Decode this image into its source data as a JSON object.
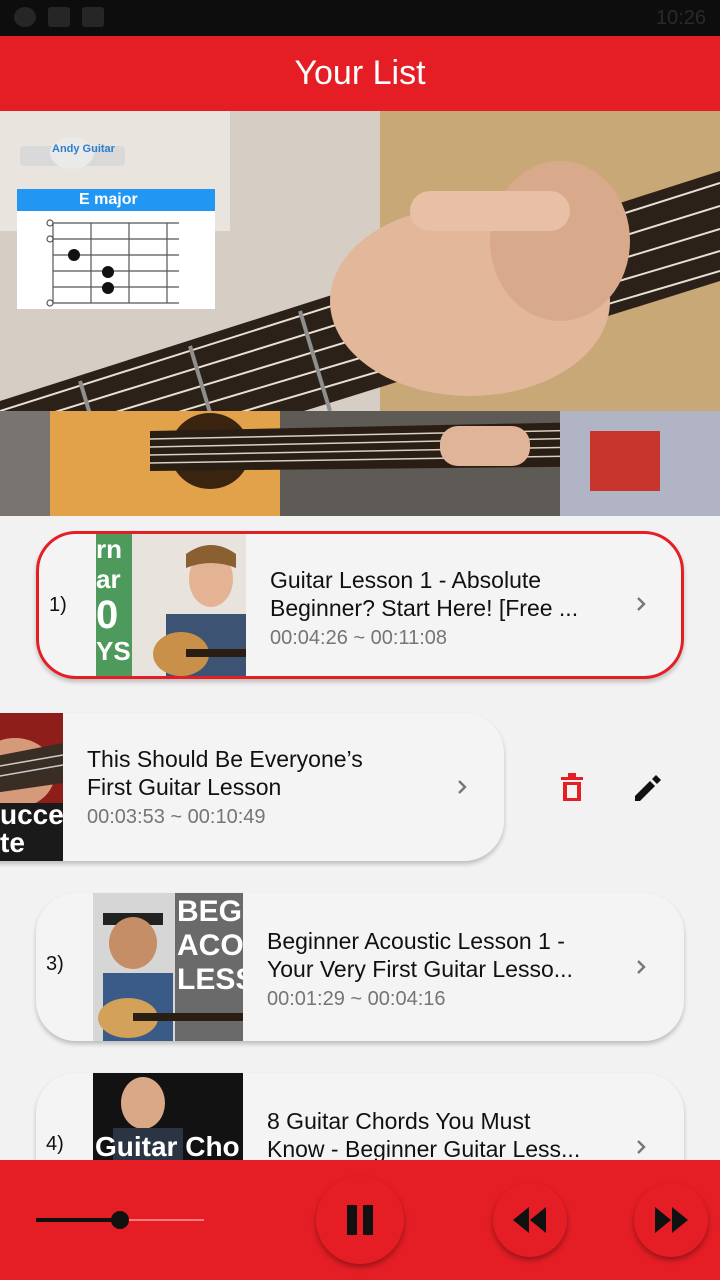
{
  "status_bar": {
    "time": "10:26"
  },
  "app_bar": {
    "title": "Your List"
  },
  "player": {
    "overlay_logo": "Andy Guitar",
    "chord_label": "E major"
  },
  "list": {
    "items": [
      {
        "index": "1)",
        "title_line1": "Guitar Lesson 1 - Absolute",
        "title_line2": "Beginner? Start Here! [Free ...",
        "range": "00:04:26 ~ 00:11:08",
        "active": true
      },
      {
        "index": "2)",
        "title_line1": "This Should Be Everyone’s",
        "title_line2": "First Guitar Lesson",
        "range": "00:03:53 ~ 00:10:49",
        "active": false
      },
      {
        "index": "3)",
        "title_line1": "Beginner Acoustic Lesson 1 -",
        "title_line2": "Your Very First Guitar Lesso...",
        "range": "00:01:29 ~ 00:04:16",
        "active": false
      },
      {
        "index": "4)",
        "title_line1": "8 Guitar Chords You Must",
        "title_line2": "Know - Beginner Guitar Less...",
        "range": "",
        "active": false
      }
    ],
    "swipe_actions": {
      "delete_icon": "trash-icon",
      "edit_icon": "pencil-icon"
    }
  },
  "thumbnail_text": {
    "t1": [
      "rn",
      "ar",
      "0",
      "YS"
    ],
    "t2": [
      "ucce",
      "te"
    ],
    "t3": [
      "BEGIN",
      "ACOU",
      "LESS"
    ],
    "t4": [
      "Guitar Cho"
    ]
  },
  "controls": {
    "progress": 0.5,
    "pause_icon": "pause-icon",
    "rewind_icon": "rewind-icon",
    "forward_icon": "fast-forward-icon"
  },
  "colors": {
    "accent": "#e51e25",
    "delete": "#e51e25"
  }
}
